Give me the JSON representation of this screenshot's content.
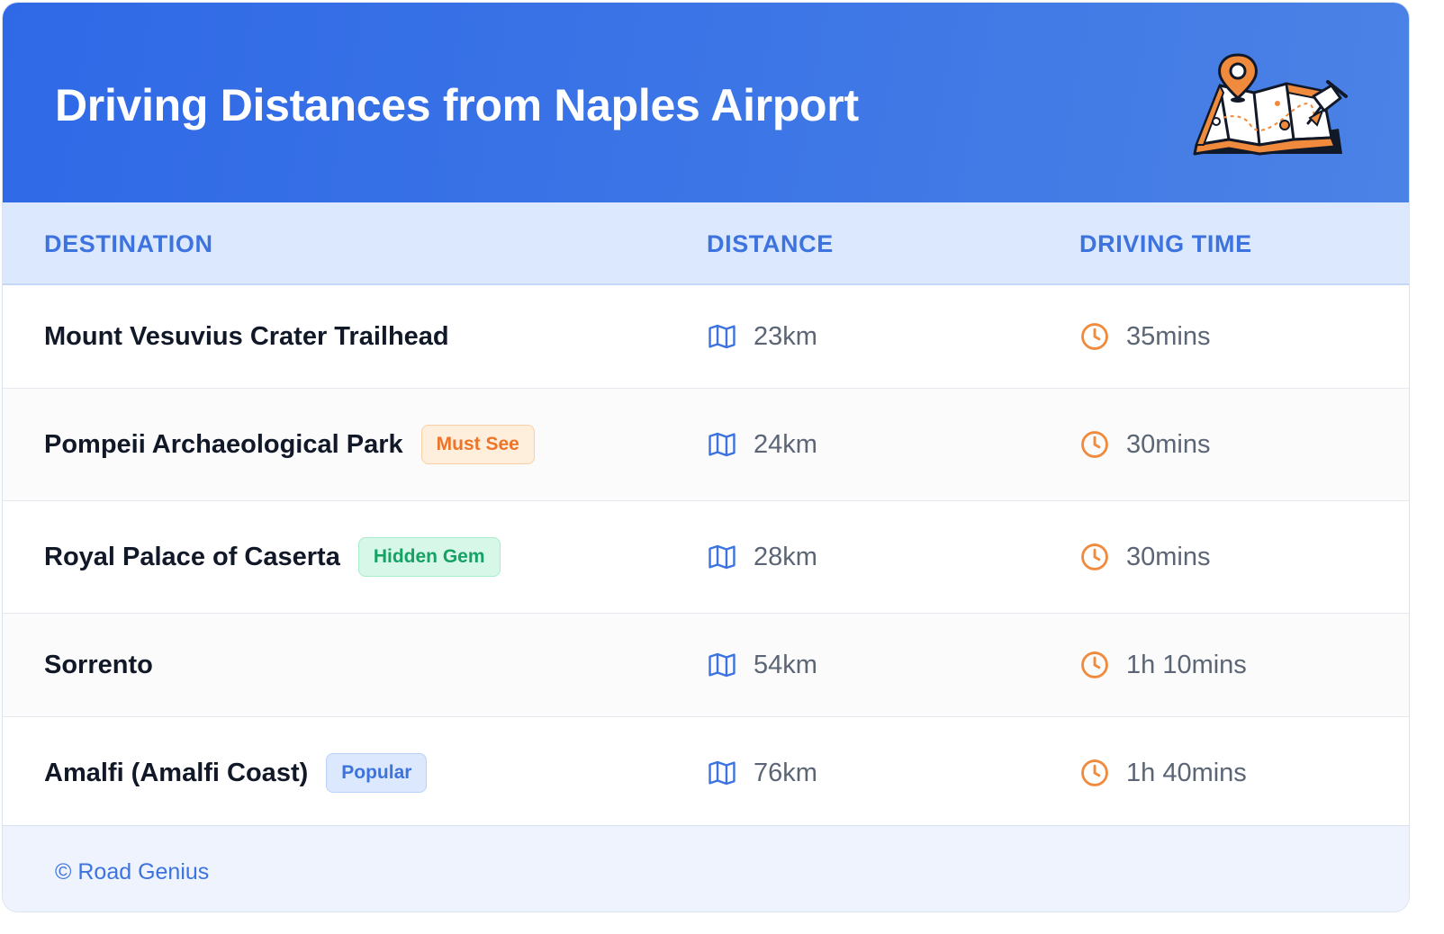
{
  "header": {
    "title": "Driving Distances from Naples Airport"
  },
  "table": {
    "columns": [
      "DESTINATION",
      "DISTANCE",
      "DRIVING TIME"
    ],
    "rows": [
      {
        "destination": "Mount Vesuvius Crater Trailhead",
        "badge": "",
        "distance": "23km",
        "time": "35mins"
      },
      {
        "destination": "Pompeii Archaeological Park",
        "badge": "Must See",
        "distance": "24km",
        "time": "30mins"
      },
      {
        "destination": "Royal Palace of Caserta",
        "badge": "Hidden Gem",
        "distance": "28km",
        "time": "30mins"
      },
      {
        "destination": "Sorrento",
        "badge": "",
        "distance": "54km",
        "time": "1h 10mins"
      },
      {
        "destination": "Amalfi (Amalfi Coast)",
        "badge": "Popular",
        "distance": "76km",
        "time": "1h 40mins"
      }
    ]
  },
  "icons": {
    "header": "map-with-pin-icon",
    "distance": "map-icon",
    "time": "clock-icon"
  },
  "colors": {
    "header_bg": "#2f69e6",
    "header_text": "#ffffff",
    "column_header_text": "#3d73de",
    "map_icon": "#3d73de",
    "clock_icon": "#f08a3c",
    "badge_must_see": "#ed7428",
    "badge_hidden_gem": "#16a265",
    "badge_popular": "#3d73de"
  },
  "footer": {
    "credit": "© Road Genius"
  }
}
